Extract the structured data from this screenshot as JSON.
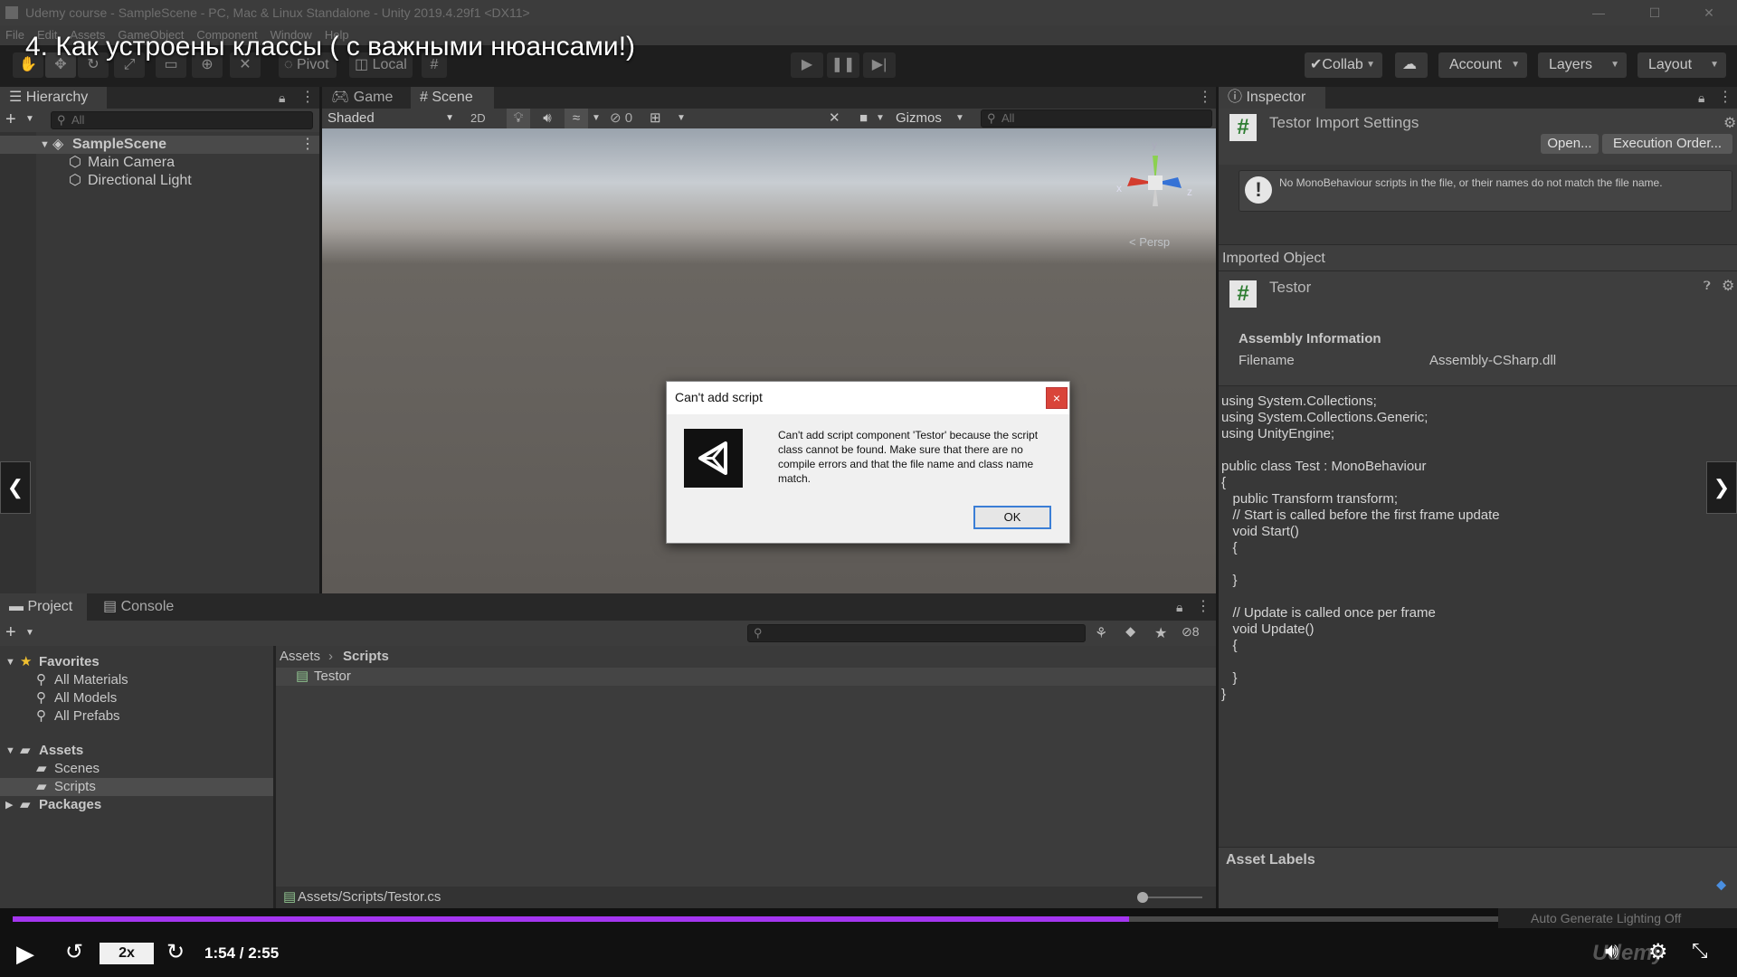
{
  "window": {
    "title": "Udemy course - SampleScene - PC, Mac & Linux Standalone - Unity 2019.4.29f1 <DX11>",
    "menu": [
      "File",
      "Edit",
      "Assets",
      "GameObject",
      "Component",
      "Window",
      "Help"
    ]
  },
  "overlay_title": "4. Как устроены классы ( с важными нюансами!)",
  "toolbar": {
    "pivot_label": "Pivot",
    "local_label": "Local",
    "collab_label": "Collab",
    "account_label": "Account",
    "layers_label": "Layers",
    "layout_label": "Layout"
  },
  "hierarchy": {
    "tab_label": "Hierarchy",
    "search_placeholder": "All",
    "scene_name": "SampleScene",
    "items": [
      "Main Camera",
      "Directional Light"
    ]
  },
  "scene": {
    "tab_game": "Game",
    "tab_scene": "Scene",
    "shading_mode": "Shaded",
    "toggle_2d": "2D",
    "hidden_count": "0",
    "gizmos_label": "Gizmos",
    "search_placeholder": "All",
    "persp_label": "< Persp",
    "axis_x": "x",
    "axis_y": "y",
    "axis_z": "z"
  },
  "dialog": {
    "title": "Can't add script",
    "close_glyph": "×",
    "message": "Can't add script component 'Testor' because the script class cannot be found. Make sure that there are no compile errors and that the file name and class name match.",
    "ok_label": "OK"
  },
  "project": {
    "tab_project": "Project",
    "tab_console": "Console",
    "hidden_count": "8",
    "favorites_label": "Favorites",
    "favorites": [
      "All Materials",
      "All Models",
      "All Prefabs"
    ],
    "assets_label": "Assets",
    "asset_folders": [
      "Scenes",
      "Scripts"
    ],
    "packages_label": "Packages",
    "breadcrumb_root": "Assets",
    "breadcrumb_current": "Scripts",
    "files": [
      "Testor"
    ],
    "footer_path": "Assets/Scripts/Testor.cs"
  },
  "inspector": {
    "tab_label": "Inspector",
    "header_title": "Testor Import Settings",
    "open_button": "Open...",
    "execution_order_button": "Execution Order...",
    "warning": "No MonoBehaviour scripts in the file, or their names do not match the file name.",
    "imported_object_label": "Imported Object",
    "object_name": "Testor",
    "assembly_header": "Assembly Information",
    "filename_label": "Filename",
    "filename_value": "Assembly-CSharp.dll",
    "code_lines": [
      "using System.Collections;",
      "using System.Collections.Generic;",
      "using UnityEngine;",
      "",
      "public class Test : MonoBehaviour",
      "{",
      "   public Transform transform;",
      "   // Start is called before the first frame update",
      "   void Start()",
      "   {",
      "",
      "   }",
      "",
      "   // Update is called once per frame",
      "   void Update()",
      "   {",
      "",
      "   }",
      "}"
    ],
    "asset_labels_header": "Asset Labels"
  },
  "status": {
    "message": "Auto Generate Lighting Off"
  },
  "player": {
    "speed": "2x",
    "time": "1:54 / 2:55",
    "progress": 0.652,
    "brand": "Udemy"
  },
  "colors": {
    "progress_fill": "#a435f0",
    "accent_blue": "#3b7ed6",
    "dialog_close": "#d9443a",
    "panel_bg": "#383838"
  }
}
